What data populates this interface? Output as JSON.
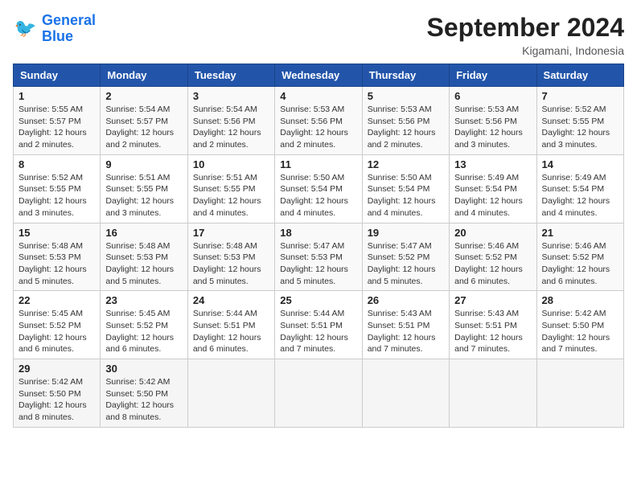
{
  "header": {
    "logo_line1": "General",
    "logo_line2": "Blue",
    "month_title": "September 2024",
    "location": "Kigamani, Indonesia"
  },
  "weekdays": [
    "Sunday",
    "Monday",
    "Tuesday",
    "Wednesday",
    "Thursday",
    "Friday",
    "Saturday"
  ],
  "weeks": [
    [
      {
        "day": "1",
        "sunrise": "5:55 AM",
        "sunset": "5:57 PM",
        "daylight": "12 hours and 2 minutes."
      },
      {
        "day": "2",
        "sunrise": "5:54 AM",
        "sunset": "5:57 PM",
        "daylight": "12 hours and 2 minutes."
      },
      {
        "day": "3",
        "sunrise": "5:54 AM",
        "sunset": "5:56 PM",
        "daylight": "12 hours and 2 minutes."
      },
      {
        "day": "4",
        "sunrise": "5:53 AM",
        "sunset": "5:56 PM",
        "daylight": "12 hours and 2 minutes."
      },
      {
        "day": "5",
        "sunrise": "5:53 AM",
        "sunset": "5:56 PM",
        "daylight": "12 hours and 2 minutes."
      },
      {
        "day": "6",
        "sunrise": "5:53 AM",
        "sunset": "5:56 PM",
        "daylight": "12 hours and 3 minutes."
      },
      {
        "day": "7",
        "sunrise": "5:52 AM",
        "sunset": "5:55 PM",
        "daylight": "12 hours and 3 minutes."
      }
    ],
    [
      {
        "day": "8",
        "sunrise": "5:52 AM",
        "sunset": "5:55 PM",
        "daylight": "12 hours and 3 minutes."
      },
      {
        "day": "9",
        "sunrise": "5:51 AM",
        "sunset": "5:55 PM",
        "daylight": "12 hours and 3 minutes."
      },
      {
        "day": "10",
        "sunrise": "5:51 AM",
        "sunset": "5:55 PM",
        "daylight": "12 hours and 4 minutes."
      },
      {
        "day": "11",
        "sunrise": "5:50 AM",
        "sunset": "5:54 PM",
        "daylight": "12 hours and 4 minutes."
      },
      {
        "day": "12",
        "sunrise": "5:50 AM",
        "sunset": "5:54 PM",
        "daylight": "12 hours and 4 minutes."
      },
      {
        "day": "13",
        "sunrise": "5:49 AM",
        "sunset": "5:54 PM",
        "daylight": "12 hours and 4 minutes."
      },
      {
        "day": "14",
        "sunrise": "5:49 AM",
        "sunset": "5:54 PM",
        "daylight": "12 hours and 4 minutes."
      }
    ],
    [
      {
        "day": "15",
        "sunrise": "5:48 AM",
        "sunset": "5:53 PM",
        "daylight": "12 hours and 5 minutes."
      },
      {
        "day": "16",
        "sunrise": "5:48 AM",
        "sunset": "5:53 PM",
        "daylight": "12 hours and 5 minutes."
      },
      {
        "day": "17",
        "sunrise": "5:48 AM",
        "sunset": "5:53 PM",
        "daylight": "12 hours and 5 minutes."
      },
      {
        "day": "18",
        "sunrise": "5:47 AM",
        "sunset": "5:53 PM",
        "daylight": "12 hours and 5 minutes."
      },
      {
        "day": "19",
        "sunrise": "5:47 AM",
        "sunset": "5:52 PM",
        "daylight": "12 hours and 5 minutes."
      },
      {
        "day": "20",
        "sunrise": "5:46 AM",
        "sunset": "5:52 PM",
        "daylight": "12 hours and 6 minutes."
      },
      {
        "day": "21",
        "sunrise": "5:46 AM",
        "sunset": "5:52 PM",
        "daylight": "12 hours and 6 minutes."
      }
    ],
    [
      {
        "day": "22",
        "sunrise": "5:45 AM",
        "sunset": "5:52 PM",
        "daylight": "12 hours and 6 minutes."
      },
      {
        "day": "23",
        "sunrise": "5:45 AM",
        "sunset": "5:52 PM",
        "daylight": "12 hours and 6 minutes."
      },
      {
        "day": "24",
        "sunrise": "5:44 AM",
        "sunset": "5:51 PM",
        "daylight": "12 hours and 6 minutes."
      },
      {
        "day": "25",
        "sunrise": "5:44 AM",
        "sunset": "5:51 PM",
        "daylight": "12 hours and 7 minutes."
      },
      {
        "day": "26",
        "sunrise": "5:43 AM",
        "sunset": "5:51 PM",
        "daylight": "12 hours and 7 minutes."
      },
      {
        "day": "27",
        "sunrise": "5:43 AM",
        "sunset": "5:51 PM",
        "daylight": "12 hours and 7 minutes."
      },
      {
        "day": "28",
        "sunrise": "5:42 AM",
        "sunset": "5:50 PM",
        "daylight": "12 hours and 7 minutes."
      }
    ],
    [
      {
        "day": "29",
        "sunrise": "5:42 AM",
        "sunset": "5:50 PM",
        "daylight": "12 hours and 8 minutes."
      },
      {
        "day": "30",
        "sunrise": "5:42 AM",
        "sunset": "5:50 PM",
        "daylight": "12 hours and 8 minutes."
      },
      null,
      null,
      null,
      null,
      null
    ]
  ],
  "labels": {
    "sunrise": "Sunrise:",
    "sunset": "Sunset:",
    "daylight": "Daylight:"
  }
}
